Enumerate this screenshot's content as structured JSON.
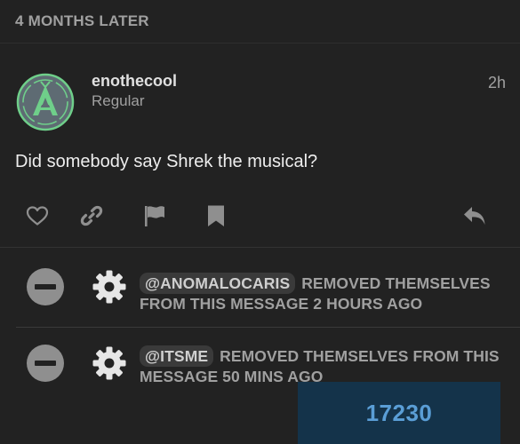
{
  "time_gap": "4 MONTHS LATER",
  "post": {
    "username": "enothecool",
    "user_title": "Regular",
    "date": "2h",
    "body": "Did somebody say Shrek the musical?"
  },
  "actions": [
    "heart-icon",
    "link-icon",
    "flag-icon",
    "bookmark-icon",
    "reply-icon"
  ],
  "small_actions": [
    {
      "mention": "@ANOMALOCARIS",
      "text": "REMOVED THEMSELVES FROM THIS MESSAGE 2 HOURS AGO"
    },
    {
      "mention": "@ITSME",
      "text": "REMOVED THEMSELVES FROM THIS MESSAGE 50 MINS AGO"
    }
  ],
  "counter": "17230",
  "colors": {
    "background": "#222222",
    "avatar_ring": "#6fcf8a",
    "avatar_fill": "#5e6b73",
    "counter_bg": "#14334a",
    "counter_text": "#5a9ed6"
  }
}
